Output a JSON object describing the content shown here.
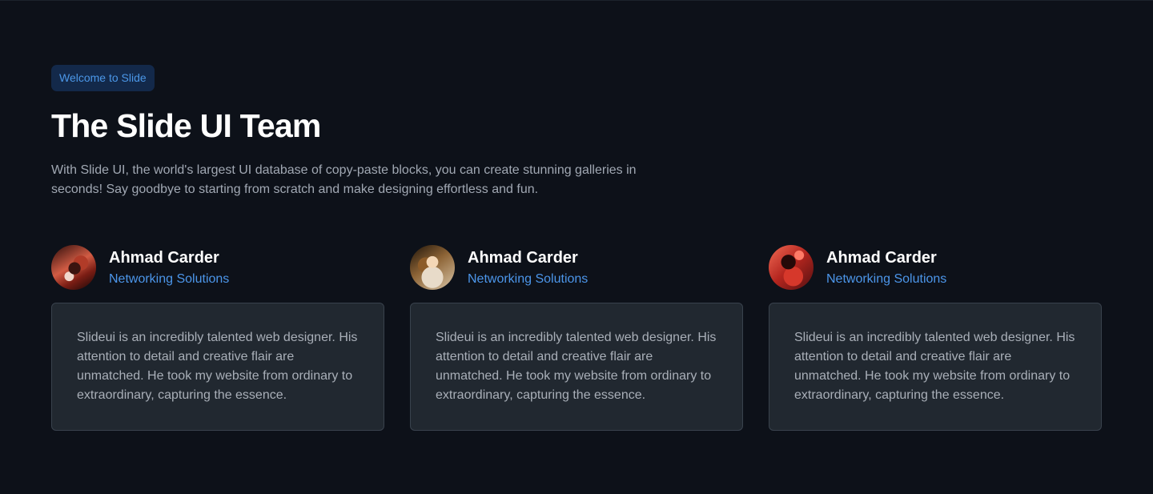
{
  "header": {
    "badge": "Welcome to Slide",
    "title": "The Slide UI Team",
    "description": "With Slide UI, the world's largest UI database of copy-paste blocks, you can create stunning galleries in seconds! Say goodbye to starting from scratch and make designing effortless and fun."
  },
  "team": [
    {
      "name": "Ahmad Carder",
      "role": "Networking Solutions",
      "avatar": "profile-photo",
      "quote": "Slideui is an incredibly talented web designer. His attention to detail and creative flair are unmatched. He took my website from ordinary to extraordinary, capturing the essence."
    },
    {
      "name": "Ahmad Carder",
      "role": "Networking Solutions",
      "avatar": "profile-photo",
      "quote": "Slideui is an incredibly talented web designer. His attention to detail and creative flair are unmatched. He took my website from ordinary to extraordinary, capturing the essence."
    },
    {
      "name": "Ahmad Carder",
      "role": "Networking Solutions",
      "avatar": "profile-photo",
      "quote": "Slideui is an incredibly talented web designer. His attention to detail and creative flair are unmatched. He took my website from ordinary to extraordinary, capturing the essence."
    }
  ],
  "colors": {
    "background": "#0d1119",
    "badge_background": "#13294a",
    "accent": "#4c96ea",
    "card_background": "#212830",
    "card_border": "#39424d",
    "heading": "#ffffff",
    "body_text": "#a1a8b3"
  }
}
